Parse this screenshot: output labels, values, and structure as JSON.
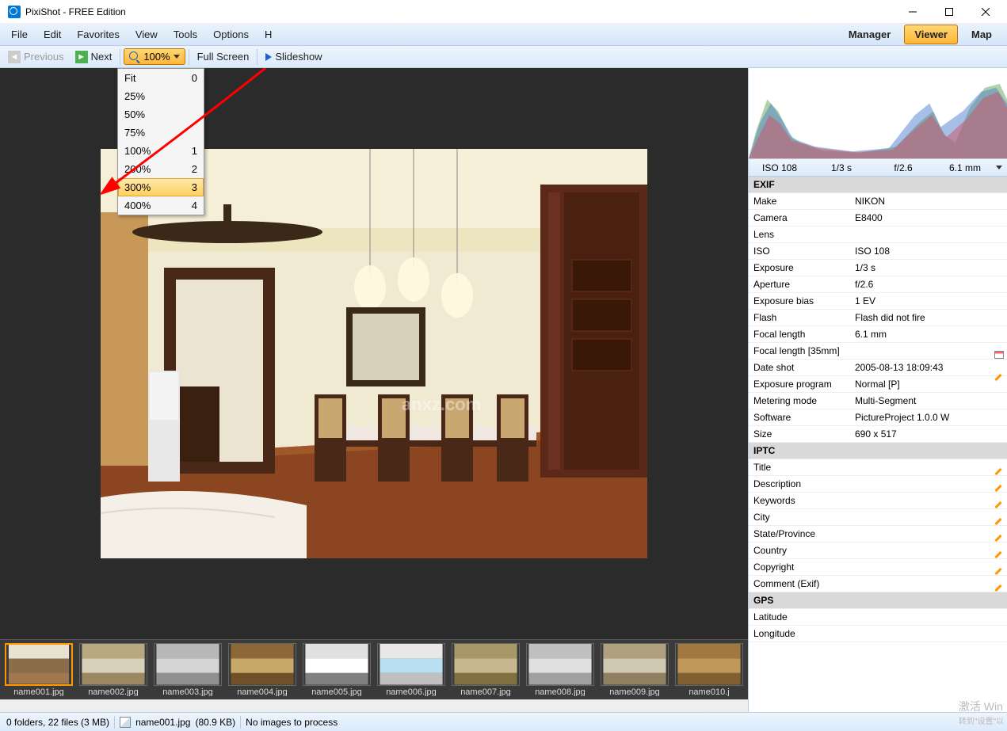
{
  "titlebar": {
    "title": "PixiShot  -  FREE Edition"
  },
  "menubar": {
    "items": [
      "File",
      "Edit",
      "Favorites",
      "View",
      "Tools",
      "Options",
      "H"
    ],
    "modes": {
      "manager": "Manager",
      "viewer": "Viewer",
      "map": "Map"
    }
  },
  "toolbar": {
    "previous": "Previous",
    "next": "Next",
    "zoom_value": "100%",
    "fullscreen": "Full Screen",
    "slideshow": "Slideshow"
  },
  "zoom_dropdown": [
    {
      "label": "Fit",
      "key": "0"
    },
    {
      "label": "25%",
      "key": ""
    },
    {
      "label": "50%",
      "key": ""
    },
    {
      "label": "75%",
      "key": ""
    },
    {
      "label": "100%",
      "key": "1"
    },
    {
      "label": "200%",
      "key": "2"
    },
    {
      "label": "300%",
      "key": "3",
      "highlight": true
    },
    {
      "label": "400%",
      "key": "4"
    }
  ],
  "exif_summary": [
    "ISO 108",
    "1/3 s",
    "f/2.6",
    "6.1 mm"
  ],
  "metadata": [
    {
      "section": "EXIF"
    },
    {
      "k": "Make",
      "v": "NIKON"
    },
    {
      "k": "Camera",
      "v": "E8400"
    },
    {
      "k": "Lens",
      "v": ""
    },
    {
      "k": "ISO",
      "v": "ISO 108"
    },
    {
      "k": "Exposure",
      "v": "1/3 s"
    },
    {
      "k": "Aperture",
      "v": "f/2.6"
    },
    {
      "k": "Exposure bias",
      "v": "1 EV"
    },
    {
      "k": "Flash",
      "v": "Flash did not fire"
    },
    {
      "k": "Focal length",
      "v": "6.1 mm"
    },
    {
      "k": "Focal length [35mm]",
      "v": "",
      "icon": "cal"
    },
    {
      "k": "Date shot",
      "v": "2005-08-13 18:09:43",
      "icon": "edit"
    },
    {
      "k": "Exposure program",
      "v": "Normal [P]"
    },
    {
      "k": "Metering mode",
      "v": "Multi-Segment"
    },
    {
      "k": "Software",
      "v": "PictureProject 1.0.0 W"
    },
    {
      "k": "Size",
      "v": "690 x 517"
    },
    {
      "section": "IPTC"
    },
    {
      "k": "Title",
      "v": "",
      "icon": "edit"
    },
    {
      "k": "Description",
      "v": "",
      "icon": "edit"
    },
    {
      "k": "Keywords",
      "v": "",
      "icon": "edit"
    },
    {
      "k": "City",
      "v": "",
      "icon": "edit"
    },
    {
      "k": "State/Province",
      "v": "",
      "icon": "edit"
    },
    {
      "k": "Country",
      "v": "",
      "icon": "edit"
    },
    {
      "k": "Copyright",
      "v": "",
      "icon": "edit"
    },
    {
      "k": "Comment (Exif)",
      "v": "",
      "icon": "edit"
    },
    {
      "section": "GPS"
    },
    {
      "k": "Latitude",
      "v": ""
    },
    {
      "k": "Longitude",
      "v": ""
    }
  ],
  "thumbnails": [
    "name001.jpg",
    "name002.jpg",
    "name003.jpg",
    "name004.jpg",
    "name005.jpg",
    "name006.jpg",
    "name007.jpg",
    "name008.jpg",
    "name009.jpg",
    "name010.j"
  ],
  "thumb_colors": [
    [
      "#8c6d4a",
      "#e8e2d0",
      "#a07850"
    ],
    [
      "#d8d0b8",
      "#b8a880",
      "#9c8860"
    ],
    [
      "#d4d4d4",
      "#b8b8b8",
      "#909090"
    ],
    [
      "#c8a868",
      "#8c6838",
      "#705028"
    ],
    [
      "#ffffff",
      "#e0e0e0",
      "#808080"
    ],
    [
      "#b8e0f0",
      "#e8e8e8",
      "#c0c0c0"
    ],
    [
      "#c8b890",
      "#a89868",
      "#807040"
    ],
    [
      "#e0e0e0",
      "#c0c0c0",
      "#a0a0a0"
    ],
    [
      "#d0c8b0",
      "#b0a080",
      "#908060"
    ],
    [
      "#c09858",
      "#a07840",
      "#806030"
    ]
  ],
  "statusbar": {
    "folders": "0 folders,  22 files  (3 MB)",
    "current_file": "name001.jpg",
    "file_size": "(80.9 KB)",
    "process": "No images to process"
  },
  "watermark": "激活 Win",
  "watermark2": "转到\"设置\"以"
}
